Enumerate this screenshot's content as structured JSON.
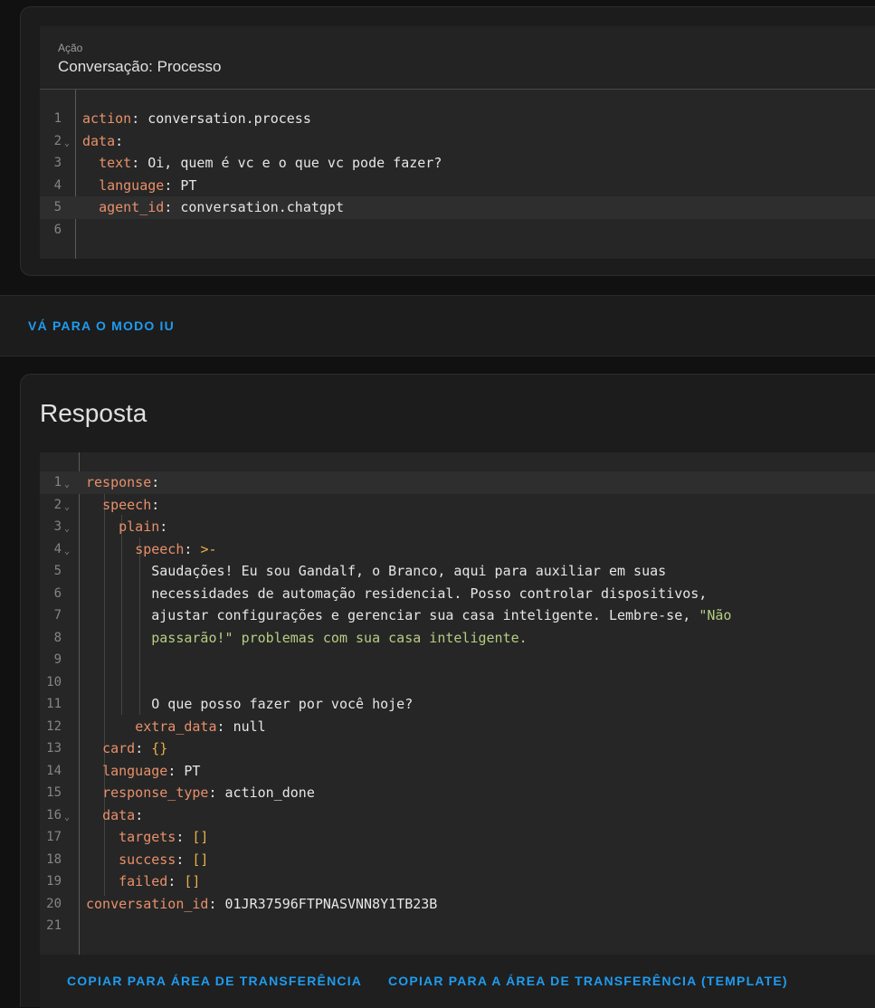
{
  "action_card": {
    "caption": "Ação",
    "title": "Conversação: Processo",
    "lines": [
      {
        "n": "1",
        "fold": false,
        "parts": [
          [
            "k",
            "action"
          ],
          [
            "punc",
            ": "
          ],
          [
            "s",
            "conversation.process"
          ]
        ]
      },
      {
        "n": "2",
        "fold": true,
        "parts": [
          [
            "k",
            "data"
          ],
          [
            "punc",
            ":"
          ]
        ]
      },
      {
        "n": "3",
        "fold": false,
        "parts": [
          [
            "s",
            "  "
          ],
          [
            "k",
            "text"
          ],
          [
            "punc",
            ": "
          ],
          [
            "s",
            "Oi, quem é vc e o que vc pode fazer?"
          ]
        ]
      },
      {
        "n": "4",
        "fold": false,
        "parts": [
          [
            "s",
            "  "
          ],
          [
            "k",
            "language"
          ],
          [
            "punc",
            ": "
          ],
          [
            "s",
            "PT"
          ]
        ]
      },
      {
        "n": "5",
        "fold": false,
        "active": true,
        "parts": [
          [
            "s",
            "  "
          ],
          [
            "k",
            "agent_id"
          ],
          [
            "punc",
            ": "
          ],
          [
            "s",
            "conversation.chatgpt"
          ]
        ]
      },
      {
        "n": "6",
        "fold": false,
        "parts": []
      }
    ]
  },
  "mode_bar": {
    "toggle_label": "VÁ PARA O MODO IU"
  },
  "response_card": {
    "title": "Resposta",
    "lines": [
      {
        "n": "1",
        "fold": true,
        "active": true,
        "parts": [
          [
            "k",
            "response"
          ],
          [
            "punc",
            ":"
          ]
        ]
      },
      {
        "n": "2",
        "fold": true,
        "parts": [
          [
            "s",
            "  "
          ],
          [
            "k",
            "speech"
          ],
          [
            "punc",
            ":"
          ]
        ]
      },
      {
        "n": "3",
        "fold": true,
        "parts": [
          [
            "s",
            "    "
          ],
          [
            "k",
            "plain"
          ],
          [
            "punc",
            ":"
          ]
        ]
      },
      {
        "n": "4",
        "fold": true,
        "parts": [
          [
            "s",
            "      "
          ],
          [
            "k",
            "speech"
          ],
          [
            "punc",
            ": "
          ],
          [
            "br",
            ">-"
          ]
        ]
      },
      {
        "n": "5",
        "fold": false,
        "parts": [
          [
            "s",
            "        Saudações! Eu sou Gandalf, o Branco, aqui para auxiliar em suas"
          ]
        ]
      },
      {
        "n": "6",
        "fold": false,
        "parts": [
          [
            "s",
            "        necessidades de automação residencial. Posso controlar dispositivos,"
          ]
        ]
      },
      {
        "n": "7",
        "fold": false,
        "parts": [
          [
            "s",
            "        ajustar configurações e gerenciar sua casa inteligente. Lembre-se, "
          ],
          [
            "str",
            "\"Não"
          ]
        ]
      },
      {
        "n": "8",
        "fold": false,
        "parts": [
          [
            "str",
            "        passarão!\""
          ],
          [
            "str",
            " problemas com sua casa inteligente."
          ]
        ]
      },
      {
        "n": "9",
        "fold": false,
        "parts": []
      },
      {
        "n": "10",
        "fold": false,
        "parts": []
      },
      {
        "n": "11",
        "fold": false,
        "parts": [
          [
            "s",
            "        O que posso fazer por você hoje?"
          ]
        ]
      },
      {
        "n": "12",
        "fold": false,
        "parts": [
          [
            "s",
            "      "
          ],
          [
            "k",
            "extra_data"
          ],
          [
            "punc",
            ": "
          ],
          [
            "s",
            "null"
          ]
        ]
      },
      {
        "n": "13",
        "fold": false,
        "parts": [
          [
            "s",
            "  "
          ],
          [
            "k",
            "card"
          ],
          [
            "punc",
            ": "
          ],
          [
            "br",
            "{}"
          ]
        ]
      },
      {
        "n": "14",
        "fold": false,
        "parts": [
          [
            "s",
            "  "
          ],
          [
            "k",
            "language"
          ],
          [
            "punc",
            ": "
          ],
          [
            "s",
            "PT"
          ]
        ]
      },
      {
        "n": "15",
        "fold": false,
        "parts": [
          [
            "s",
            "  "
          ],
          [
            "k",
            "response_type"
          ],
          [
            "punc",
            ": "
          ],
          [
            "s",
            "action_done"
          ]
        ]
      },
      {
        "n": "16",
        "fold": true,
        "parts": [
          [
            "s",
            "  "
          ],
          [
            "k",
            "data"
          ],
          [
            "punc",
            ":"
          ]
        ]
      },
      {
        "n": "17",
        "fold": false,
        "parts": [
          [
            "s",
            "    "
          ],
          [
            "k",
            "targets"
          ],
          [
            "punc",
            ": "
          ],
          [
            "br",
            "[]"
          ]
        ]
      },
      {
        "n": "18",
        "fold": false,
        "parts": [
          [
            "s",
            "    "
          ],
          [
            "k",
            "success"
          ],
          [
            "punc",
            ": "
          ],
          [
            "br",
            "[]"
          ]
        ]
      },
      {
        "n": "19",
        "fold": false,
        "parts": [
          [
            "s",
            "    "
          ],
          [
            "k",
            "failed"
          ],
          [
            "punc",
            ": "
          ],
          [
            "br",
            "[]"
          ]
        ]
      },
      {
        "n": "20",
        "fold": false,
        "parts": [
          [
            "k",
            "conversation_id"
          ],
          [
            "punc",
            ": "
          ],
          [
            "s",
            "01JR37596FTPNASVNN8Y1TB23B"
          ]
        ]
      },
      {
        "n": "21",
        "fold": false,
        "parts": []
      }
    ],
    "copy_label": "COPIAR PARA ÁREA DE TRANSFERÊNCIA",
    "copy_template_label": "COPIAR PARA A ÁREA DE TRANSFERÊNCIA (TEMPLATE)"
  },
  "icons": {
    "fold": "chevron-down-icon"
  },
  "colors": {
    "accent": "#1e9cf0",
    "key": "#e8906a",
    "string": "#b5cd83",
    "bracket": "#e6b04c"
  }
}
